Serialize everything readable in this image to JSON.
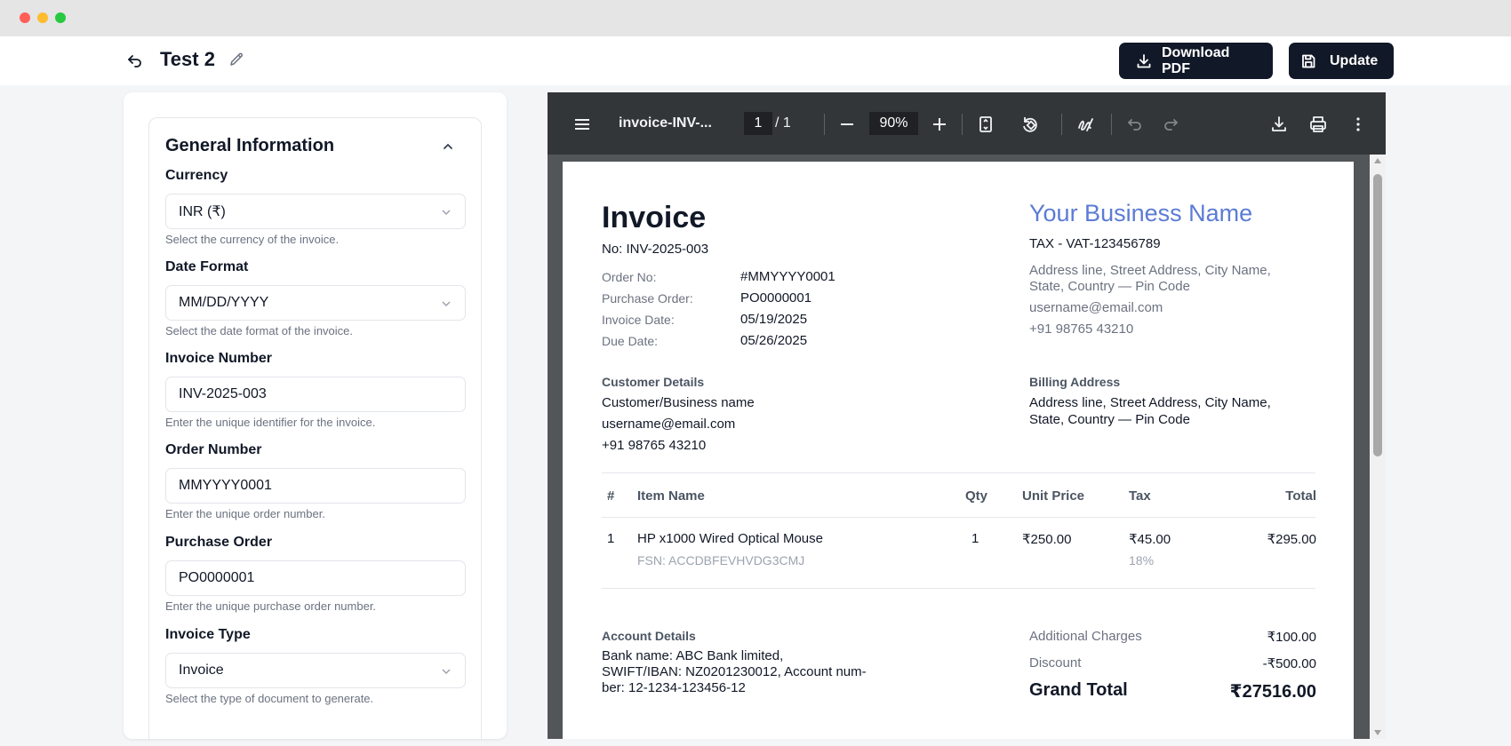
{
  "header": {
    "title": "Test 2",
    "download_label": "Download PDF",
    "update_label": "Update"
  },
  "form": {
    "section_title": "General Information",
    "fields": [
      {
        "label": "Currency",
        "value": "INR (₹)",
        "help": "Select the currency of the invoice.",
        "type": "select"
      },
      {
        "label": "Date Format",
        "value": "MM/DD/YYYY",
        "help": "Select the date format of the invoice.",
        "type": "select"
      },
      {
        "label": "Invoice Number",
        "value": "INV-2025-003",
        "help": "Enter the unique identifier for the invoice.",
        "type": "input"
      },
      {
        "label": "Order Number",
        "value": "MMYYYY0001",
        "help": "Enter the unique order number.",
        "type": "input"
      },
      {
        "label": "Purchase Order",
        "value": "PO0000001",
        "help": "Enter the unique purchase order number.",
        "type": "input"
      },
      {
        "label": "Invoice Type",
        "value": "Invoice",
        "help": "Select the type of document to generate.",
        "type": "select"
      }
    ]
  },
  "viewer": {
    "filename": "invoice-INV-...",
    "page_current": "1",
    "page_total": "/  1",
    "zoom": "90%"
  },
  "invoice": {
    "title": "Invoice",
    "number": "No: INV-2025-003",
    "meta": [
      {
        "label": "Order No:",
        "value": "#MMYYYY0001"
      },
      {
        "label": "Purchase Order:",
        "value": " PO0000001"
      },
      {
        "label": "Invoice Date:",
        "value": "05/19/2025"
      },
      {
        "label": "Due Date:",
        "value": "05/26/2025"
      }
    ],
    "business": {
      "name": "Your Business Name",
      "tax": "TAX - VAT-123456789",
      "address1": "Address line, Street Address, City Name,",
      "address2": "State, Country — Pin Code",
      "email": "username@email.com",
      "phone": "+91 98765 43210"
    },
    "customer": {
      "heading": "Customer Details",
      "name": "Customer/Business name",
      "email": "username@email.com",
      "phone": "+91 98765 43210"
    },
    "billing": {
      "heading": "Billing Address",
      "line1": "Address line, Street Address, City Name,",
      "line2": "State, Country — Pin Code"
    },
    "table": {
      "headers": {
        "num": "#",
        "item": "Item Name",
        "qty": "Qty",
        "unit": "Unit Price",
        "tax": "Tax",
        "total": "Total"
      },
      "rows": [
        {
          "num": "1",
          "item": "HP x1000 Wired Optical Mouse",
          "sub": "FSN: ACCDBFEVHVDG3CMJ",
          "qty": "1",
          "unit": "₹250.00",
          "tax": "₹45.00",
          "tax_rate": "18%",
          "total": "₹295.00"
        }
      ]
    },
    "account": {
      "heading": "Account Details",
      "line1": "Bank name: ABC Bank limited,",
      "line2": "SWIFT/IBAN: NZ0201230012, Account num-",
      "line3": "ber: 12-1234-123456-12"
    },
    "summary": {
      "additional_label": "Additional Charges",
      "additional_value": "₹100.00",
      "discount_label": "Discount",
      "discount_value": "-₹500.00",
      "grand_label": "Grand Total",
      "grand_value": "₹27516.00"
    }
  }
}
